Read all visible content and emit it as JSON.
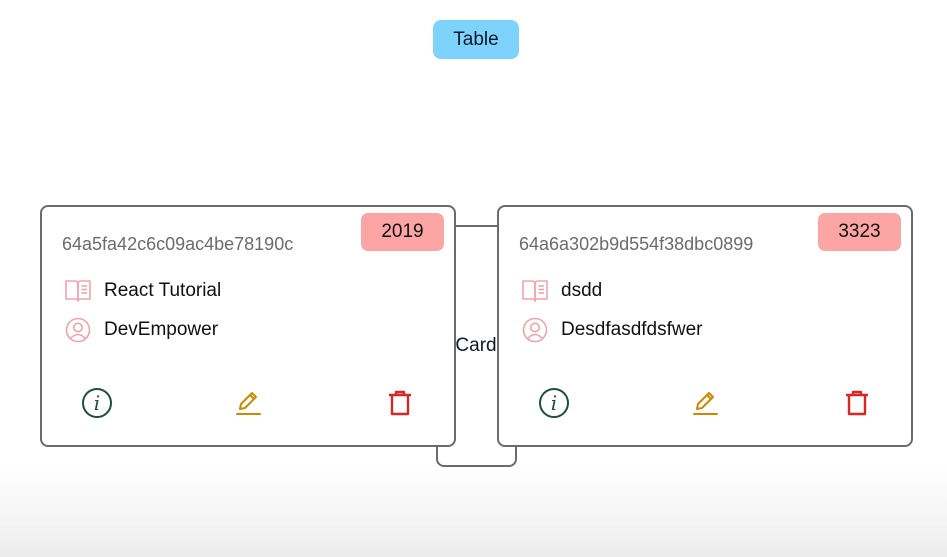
{
  "view_toggle": {
    "table_label": "Table",
    "card_label": "Card"
  },
  "colors": {
    "toggle_bg": "#7dd3fc",
    "badge_bg": "#fca5a5",
    "info_icon": "#1f4e3d",
    "edit_icon": "#ca8a04",
    "delete_icon": "#dc2626",
    "field_icon": "#f0a3a8"
  },
  "cards": [
    {
      "id": "64a5fa42c6c09ac4be78190c",
      "year": "2019",
      "title": "React Tutorial",
      "author": "DevEmpower"
    },
    {
      "id": "64a6a302b9d554f38dbc0899",
      "year": "3323",
      "title": "dsdd",
      "author": "Desdfasdfdsfwer"
    }
  ],
  "icons": {
    "title": "book-open-icon",
    "author": "user-circle-icon",
    "info": "info-circle-icon",
    "edit": "pencil-icon",
    "delete": "trash-icon"
  }
}
